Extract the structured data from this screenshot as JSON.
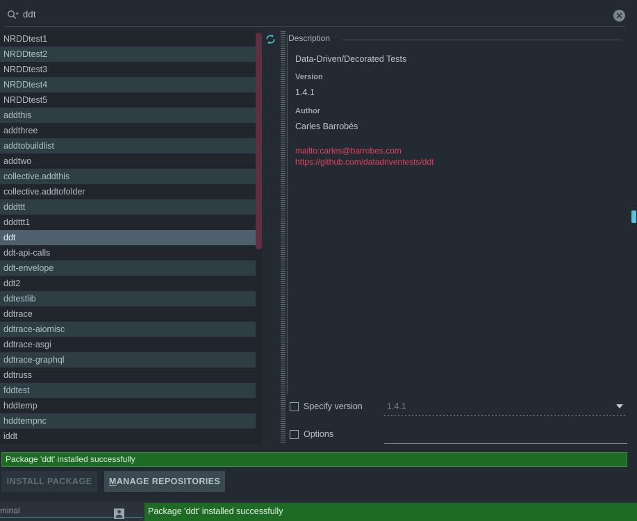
{
  "search": {
    "value": "ddt",
    "icon": "search-icon",
    "clear_icon": "clear-circle-icon"
  },
  "package_list": {
    "refresh_icon": "refresh-icon",
    "selected": "ddt",
    "items": [
      "NRDDtest1",
      "NRDDtest2",
      "NRDDtest3",
      "NRDDtest4",
      "NRDDtest5",
      "addthis",
      "addthree",
      "addtobuildlist",
      "addtwo",
      "collective.addthis",
      "collective.addtofolder",
      "dddttt",
      "dddttt1",
      "ddt",
      "ddt-api-calls",
      "ddt-envelope",
      "ddt2",
      "ddtestlib",
      "ddtrace",
      "ddtrace-aiomisc",
      "ddtrace-asgi",
      "ddtrace-graphql",
      "ddtruss",
      "fddtest",
      "hddtemp",
      "hddtempnc",
      "iddt"
    ]
  },
  "description": {
    "legend": "Description",
    "summary": "Data-Driven/Decorated Tests",
    "version_label": "Version",
    "version_value": "1.4.1",
    "author_label": "Author",
    "author_value": "Carles Barrobés",
    "links": [
      "mailto:carles@barrobes.com",
      "https://github.com/datadriventests/ddt"
    ],
    "link_color": "#e8415f"
  },
  "form": {
    "specify_version_label": "Specify version",
    "specify_version_checked": false,
    "version_field_value": "1.4.1",
    "options_label": "Options",
    "options_checked": false,
    "options_field_value": ""
  },
  "notification": {
    "message": "Package 'ddt' installed successfully",
    "background": "#1d6b24"
  },
  "actions": {
    "install_label": "INSTALL PACKAGE",
    "install_enabled": false,
    "manage_mnemonic": "M",
    "manage_label_rest": "ANAGE REPOSITORIES"
  },
  "statusbar": {
    "left_text": "minal",
    "person_icon": "person-icon",
    "message": "Package 'ddt' installed successfully"
  }
}
